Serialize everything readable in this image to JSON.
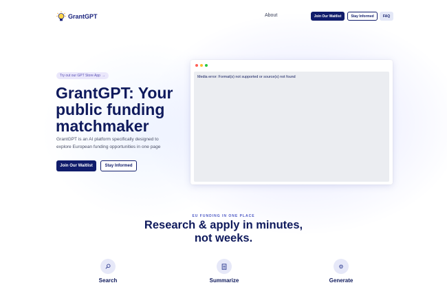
{
  "nav": {
    "logo_text": "GrantGPT",
    "about": "About",
    "join_waitlist": "Join Our Waitlist",
    "stay_informed": "Stay Informed",
    "faq": "FAQ"
  },
  "hero": {
    "pill_text": "Try out our GPT Store App",
    "pill_icon": "arrow-right-icon",
    "title": "GrantGPT: Your public funding matchmaker",
    "subtitle": "GrantGPT is an AI platform specifically designed to explore European funding opportunities in one page",
    "join_waitlist": "Join Our Waitlist",
    "stay_informed": "Stay Informed"
  },
  "preview": {
    "media_error": "Media error: Format(s) not supported or source(s) not found"
  },
  "section": {
    "eyebrow": "EU FUNDING IN ONE PLACE",
    "title": "Research & apply in minutes, not weeks."
  },
  "features": [
    {
      "label": "Search",
      "icon": "search-icon"
    },
    {
      "label": "Summarize",
      "icon": "document-icon"
    },
    {
      "label": "Generate",
      "icon": "gear-icon"
    }
  ],
  "colors": {
    "brand_navy": "#101c6b",
    "accent_purple": "#5a4fb5",
    "faq_bg": "#e4e8f7"
  }
}
